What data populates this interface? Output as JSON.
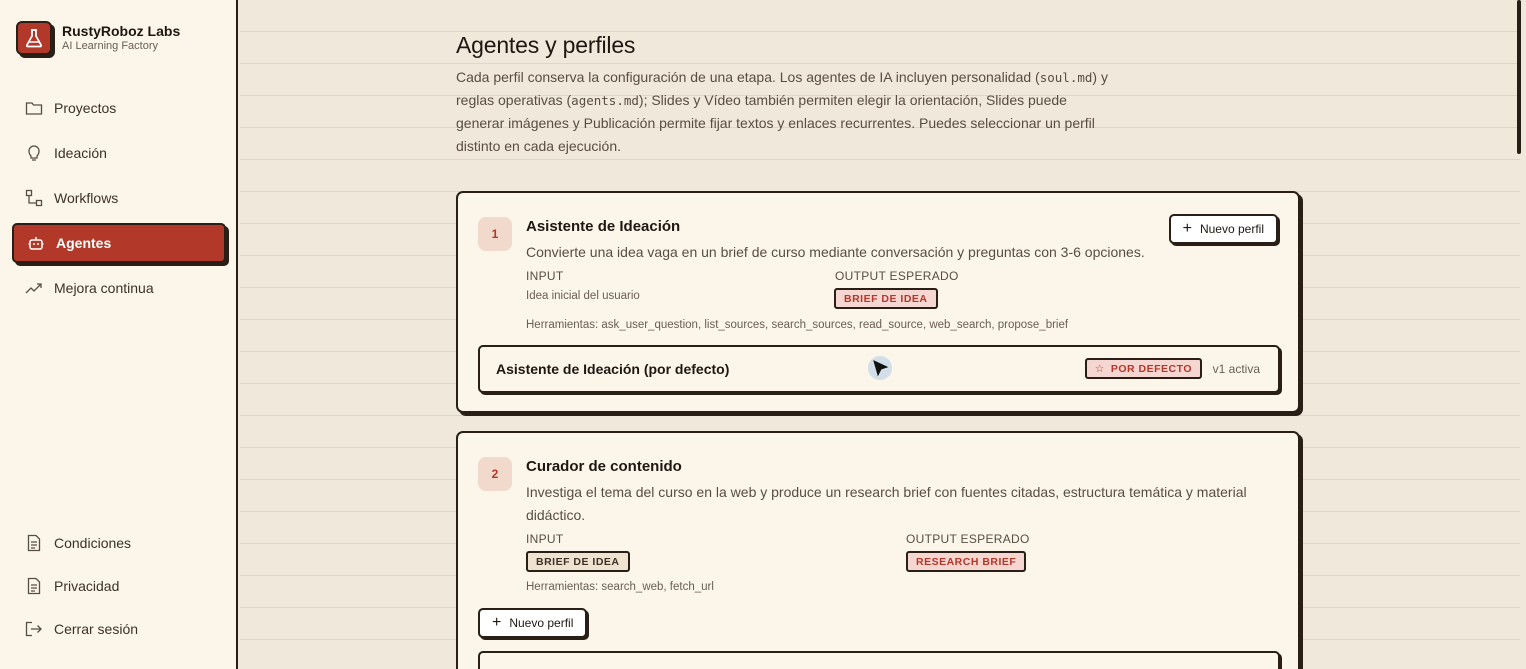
{
  "brand": {
    "name": "RustyRoboz Labs",
    "subtitle": "AI Learning Factory"
  },
  "nav": [
    {
      "label": "Proyectos",
      "icon": "folder-icon",
      "active": false
    },
    {
      "label": "Ideación",
      "icon": "lightbulb-icon",
      "active": false
    },
    {
      "label": "Workflows",
      "icon": "workflow-icon",
      "active": false
    },
    {
      "label": "Agentes",
      "icon": "robot-icon",
      "active": true
    },
    {
      "label": "Mejora continua",
      "icon": "trend-icon",
      "active": false
    }
  ],
  "nav_bottom": [
    {
      "label": "Condiciones",
      "icon": "document-icon"
    },
    {
      "label": "Privacidad",
      "icon": "document-icon"
    },
    {
      "label": "Cerrar sesión",
      "icon": "logout-icon"
    }
  ],
  "page": {
    "title": "Agentes y perfiles",
    "desc_1": "Cada perfil conserva la configuración de una etapa. Los agentes de IA incluyen personalidad (",
    "code_1": "soul.md",
    "desc_2": ") y reglas operativas (",
    "code_2": "agents.md",
    "desc_3": "); Slides y Vídeo también permiten elegir la orientación, Slides puede generar imágenes y Publicación permite fijar textos y enlaces recurrentes. Puedes seleccionar un perfil distinto en cada ejecución."
  },
  "agents": [
    {
      "step": "1",
      "title": "Asistente de Ideación",
      "description": "Convierte una idea vaga en un brief de curso mediante conversación y preguntas con 3-6 opciones.",
      "input_label": "INPUT",
      "input_value": "Idea inicial del usuario",
      "output_label": "OUTPUT ESPERADO",
      "output_tag": "BRIEF DE IDEA",
      "tools": "Herramientas: ask_user_question, list_sources, search_sources, read_source, web_search, propose_brief",
      "new_profile": "Nuevo perfil",
      "profile": {
        "name": "Asistente de Ideación (por defecto)",
        "tag": "POR DEFECTO",
        "version": "v1 activa"
      }
    },
    {
      "step": "2",
      "title": "Curador de contenido",
      "description": "Investiga el tema del curso en la web y produce un research brief con fuentes citadas, estructura temática y material didáctico.",
      "input_label": "INPUT",
      "input_tag": "BRIEF DE IDEA",
      "output_label": "OUTPUT ESPERADO",
      "output_tag": "RESEARCH BRIEF",
      "tools": "Herramientas: search_web, fetch_url",
      "new_profile": "Nuevo perfil"
    }
  ],
  "colors": {
    "accent": "#b2382a",
    "background": "#f0e8da",
    "panel": "#fbf5ea",
    "ink": "#2a1f17"
  }
}
